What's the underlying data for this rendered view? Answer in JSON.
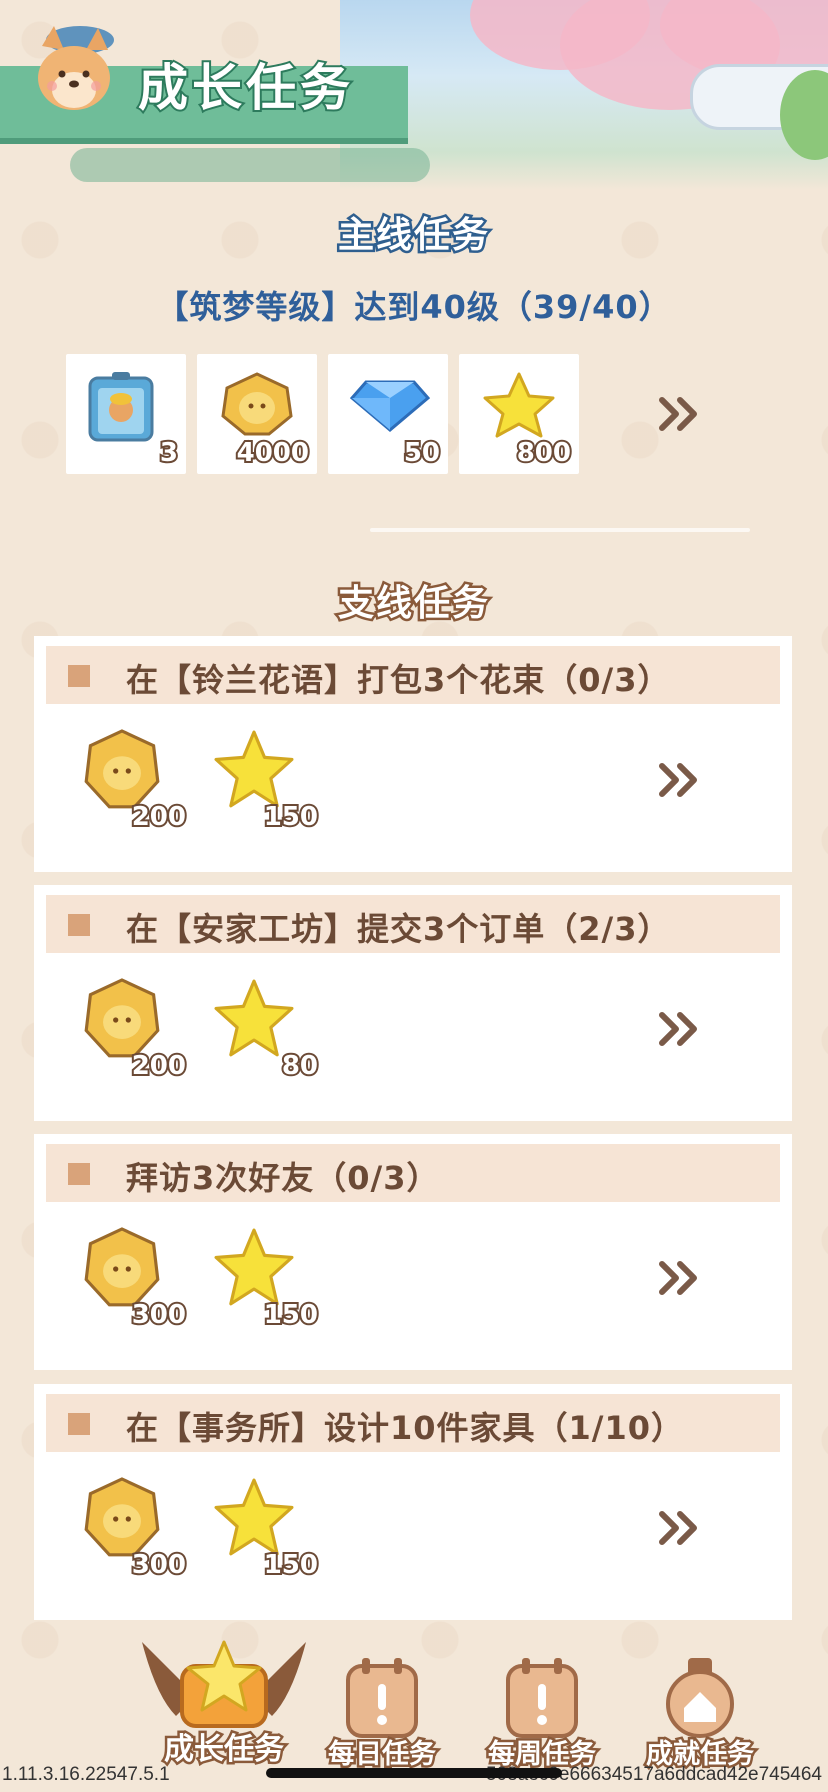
{
  "header": {
    "title": "成长任务"
  },
  "main_section": {
    "title": "主线任务",
    "task": "【筑梦等级】达到40级（39/40）",
    "rewards": [
      {
        "icon": "character-card-icon",
        "amount": "3"
      },
      {
        "icon": "coin-icon",
        "amount": "4000"
      },
      {
        "icon": "diamond-icon",
        "amount": "50"
      },
      {
        "icon": "star-icon",
        "amount": "800"
      }
    ]
  },
  "side_section": {
    "title": "支线任务",
    "tasks": [
      {
        "label": "在【铃兰花语】打包3个花束（0/3）",
        "coins": "200",
        "stars": "150"
      },
      {
        "label": "在【安家工坊】提交3个订单（2/3）",
        "coins": "200",
        "stars": "80"
      },
      {
        "label": "拜访3次好友（0/3）",
        "coins": "300",
        "stars": "150"
      },
      {
        "label": "在【事务所】设计10件家具（1/10）",
        "coins": "300",
        "stars": "150"
      }
    ]
  },
  "nav": {
    "items": [
      {
        "label": "成长任务",
        "icon": "star-badge-icon"
      },
      {
        "label": "每日任务",
        "icon": "calendar-icon"
      },
      {
        "label": "每周任务",
        "icon": "calendar-icon"
      },
      {
        "label": "成就任务",
        "icon": "medal-icon"
      }
    ]
  },
  "footer": {
    "version": "1.11.3.16.22547.5.1",
    "hash": "508aec0e66634517a6ddcad42e745464"
  },
  "colors": {
    "background": "#f3e7d8",
    "banner_green": "#6fbd99",
    "task_header": "#f6e4d5",
    "main_task_text": "#2f5f9a"
  }
}
